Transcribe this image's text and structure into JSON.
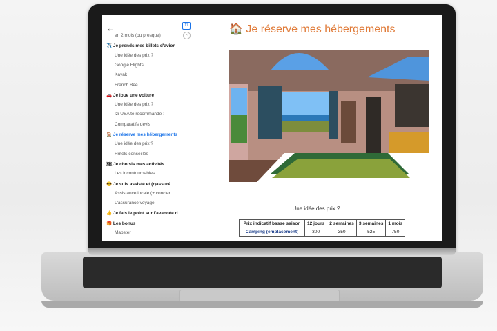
{
  "sidebar": {
    "badge": "17",
    "items": [
      {
        "label": "en 2 mois (ou presque)",
        "type": "sub"
      },
      {
        "label": "✈️ Je prends mes billets d'avion",
        "type": "section"
      },
      {
        "label": "Une idée des prix ?",
        "type": "sub"
      },
      {
        "label": "Google Flights",
        "type": "sub"
      },
      {
        "label": "Kayak",
        "type": "sub"
      },
      {
        "label": "French Bee",
        "type": "sub"
      },
      {
        "label": "🚗 Je loue une voiture",
        "type": "section"
      },
      {
        "label": "Une idée des prix ?",
        "type": "sub"
      },
      {
        "label": "Izi USA te recommande :",
        "type": "sub"
      },
      {
        "label": "Comparatifs devis",
        "type": "sub"
      },
      {
        "label": "🏠 Je réserve mes hébergements",
        "type": "section",
        "active": true
      },
      {
        "label": "Une idée des prix ?",
        "type": "sub"
      },
      {
        "label": "Hôtels conseillés",
        "type": "sub"
      },
      {
        "label": "🗺 Je choisis mes activités",
        "type": "section"
      },
      {
        "label": "Les incontournables",
        "type": "sub"
      },
      {
        "label": "😎 Je suis assisté et (r)assuré",
        "type": "section"
      },
      {
        "label": "Assistance locale (+ concier...",
        "type": "sub"
      },
      {
        "label": "L'assurance voyage",
        "type": "sub"
      },
      {
        "label": "👍 Je fais le point sur l'avancée d...",
        "type": "section"
      },
      {
        "label": "🎁 Les bonus",
        "type": "section"
      },
      {
        "label": "Mapster",
        "type": "sub"
      }
    ]
  },
  "main": {
    "title_icon": "🏠",
    "title": "Je réserve mes hébergements",
    "accent_color": "#e07b39",
    "subheading": "Une idée des prix ?",
    "table": {
      "headers": [
        "Prix indicatif basse saison",
        "12 jours",
        "2 semaines",
        "3 semaines",
        "1 mois"
      ],
      "row_label": "Camping (emplacement)",
      "row_values": [
        "300",
        "350",
        "525",
        "750"
      ]
    }
  }
}
